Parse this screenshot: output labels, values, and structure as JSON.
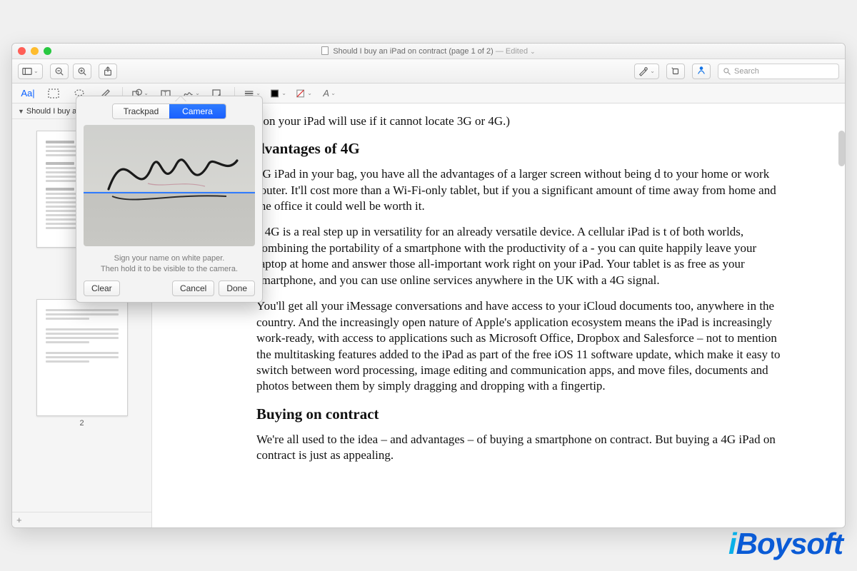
{
  "window": {
    "title": "Should I buy an iPad on contract (page 1 of 2)",
    "edited_suffix": " — Edited",
    "caret": "⌄"
  },
  "toolbar": {
    "search_placeholder": "Search"
  },
  "markup": {
    "text_style": "Aa|"
  },
  "sidebar": {
    "crumb": "Should I buy a…",
    "page2_label": "2",
    "add_label": "+"
  },
  "document": {
    "line_partial_1": "tion your iPad will use if it cannot locate 3G or 4G.)",
    "h_advantages": "dvantages of 4G",
    "p1": "4G iPad in your bag, you have all the advantages of a larger screen without being d to your home or work router. It'll cost more than a Wi-Fi-only tablet, but if you a significant amount of time away from home and the office it could well be worth it.",
    "p2": "e 4G is a real step up in versatility for an already versatile device. A cellular iPad is t of both worlds, combining the portability of a smartphone with the productivity of a - you can quite happily leave your laptop at home and answer those all-important work right on your iPad. Your tablet is as free as your smartphone, and you can use online services anywhere in the UK with a 4G signal.",
    "p3": "You'll get all your iMessage conversations and have access to your iCloud documents too, anywhere in the country. And the increasingly open nature of Apple's application ecosystem means the iPad is increasingly work-ready, with access to applications such as Microsoft Office, Dropbox and Salesforce – not to mention the multitasking features added to the iPad as part of the free iOS 11 software update, which make it easy to switch between word processing, image editing and communication apps, and move files, documents and photos between them by simply dragging and dropping with a fingertip.",
    "h_buying": "Buying on contract",
    "p4": "We're all used to the idea – and advantages – of buying a smartphone on contract. But buying a 4G iPad on contract is just as appealing."
  },
  "popover": {
    "tab_trackpad": "Trackpad",
    "tab_camera": "Camera",
    "hint1": "Sign your name on white paper.",
    "hint2": "Then hold it to be visible to the camera.",
    "clear": "Clear",
    "cancel": "Cancel",
    "done": "Done"
  },
  "watermark": {
    "prefix": "i",
    "text": "Boysoft"
  }
}
